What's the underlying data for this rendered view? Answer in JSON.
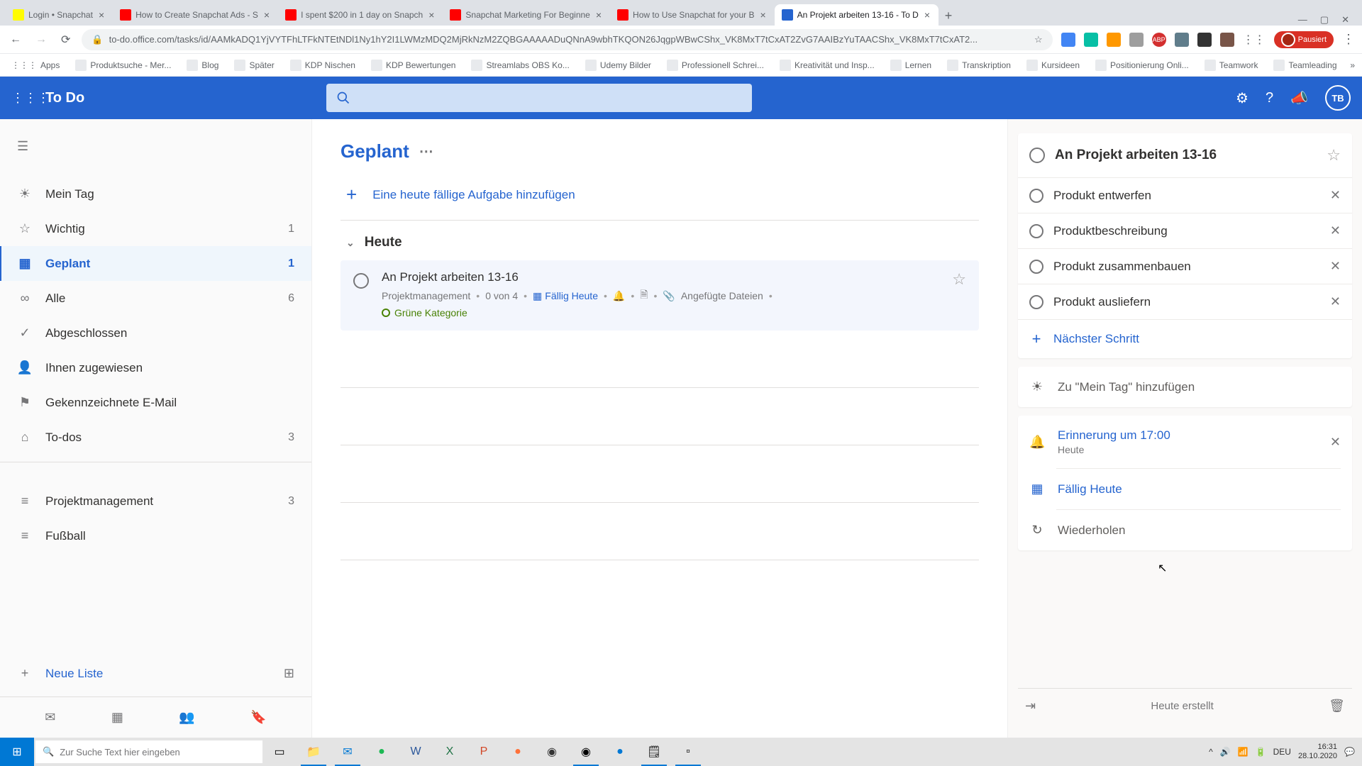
{
  "browser": {
    "tabs": [
      {
        "title": "Login • Snapchat",
        "favicon": "#fffc00"
      },
      {
        "title": "How to Create Snapchat Ads - S",
        "favicon": "#ff0000"
      },
      {
        "title": "I spent $200 in 1 day on Snapch",
        "favicon": "#ff0000"
      },
      {
        "title": "Snapchat Marketing For Beginne",
        "favicon": "#ff0000"
      },
      {
        "title": "How to Use Snapchat for your B",
        "favicon": "#ff0000"
      },
      {
        "title": "An Projekt arbeiten 13-16 - To D",
        "favicon": "#2564cf",
        "active": true
      }
    ],
    "url": "to-do.office.com/tasks/id/AAMkADQ1YjVYTFhLTFkNTEtNDl1Ny1hY2I1LWMzMDQ2MjRkNzM2ZQBGAAAAADuQNnA9wbhTKQON26JqgpWBwCShx_VK8MxT7tCxAT2ZvG7AAIBzYuTAACShx_VK8MxT7tCxAT2...",
    "pausiert": "Pausiert",
    "bookmarks": [
      "Apps",
      "Produktsuche - Mer...",
      "Blog",
      "Später",
      "KDP Nischen",
      "KDP Bewertungen",
      "Streamlabs OBS Ko...",
      "Udemy Bilder",
      "Professionell Schrei...",
      "Kreativität und Insp...",
      "Lernen",
      "Transkription",
      "Kursideen",
      "Positionierung Onli...",
      "Teamwork",
      "Teamleading"
    ]
  },
  "app": {
    "name": "To Do",
    "avatar": "TB"
  },
  "sidebar": {
    "items": [
      {
        "icon": "☀",
        "label": "Mein Tag",
        "count": ""
      },
      {
        "icon": "☆",
        "label": "Wichtig",
        "count": "1"
      },
      {
        "icon": "▦",
        "label": "Geplant",
        "count": "1",
        "active": true
      },
      {
        "icon": "∞",
        "label": "Alle",
        "count": "6"
      },
      {
        "icon": "✓",
        "label": "Abgeschlossen",
        "count": ""
      },
      {
        "icon": "👤",
        "label": "Ihnen zugewiesen",
        "count": ""
      },
      {
        "icon": "⚑",
        "label": "Gekennzeichnete E-Mail",
        "count": ""
      },
      {
        "icon": "⌂",
        "label": "To-dos",
        "count": "3"
      }
    ],
    "lists": [
      {
        "icon": "≡",
        "label": "Projektmanagement",
        "count": "3"
      },
      {
        "icon": "≡",
        "label": "Fußball",
        "count": ""
      }
    ],
    "newList": "Neue Liste"
  },
  "main": {
    "title": "Geplant",
    "addPlaceholder": "Eine heute fällige Aufgabe hinzufügen",
    "sectionTitle": "Heute",
    "task": {
      "title": "An Projekt arbeiten 13-16",
      "list": "Projektmanagement",
      "progress": "0 von 4",
      "due": "Fällig Heute",
      "attached": "Angefügte Dateien",
      "category": "Grüne Kategorie"
    }
  },
  "detail": {
    "title": "An Projekt arbeiten 13-16",
    "steps": [
      "Produkt entwerfen",
      "Produktbeschreibung",
      "Produkt zusammenbauen",
      "Produkt ausliefern"
    ],
    "nextStep": "Nächster Schritt",
    "myDay": "Zu \"Mein Tag\" hinzufügen",
    "reminder": {
      "label": "Erinnerung um 17:00",
      "sub": "Heute"
    },
    "due": "Fällig Heute",
    "repeat": "Wiederholen",
    "footer": "Heute erstellt"
  },
  "taskbar": {
    "search": "Zur Suche Text hier eingeben",
    "lang": "DEU",
    "time": "16:31",
    "date": "28.10.2020"
  }
}
